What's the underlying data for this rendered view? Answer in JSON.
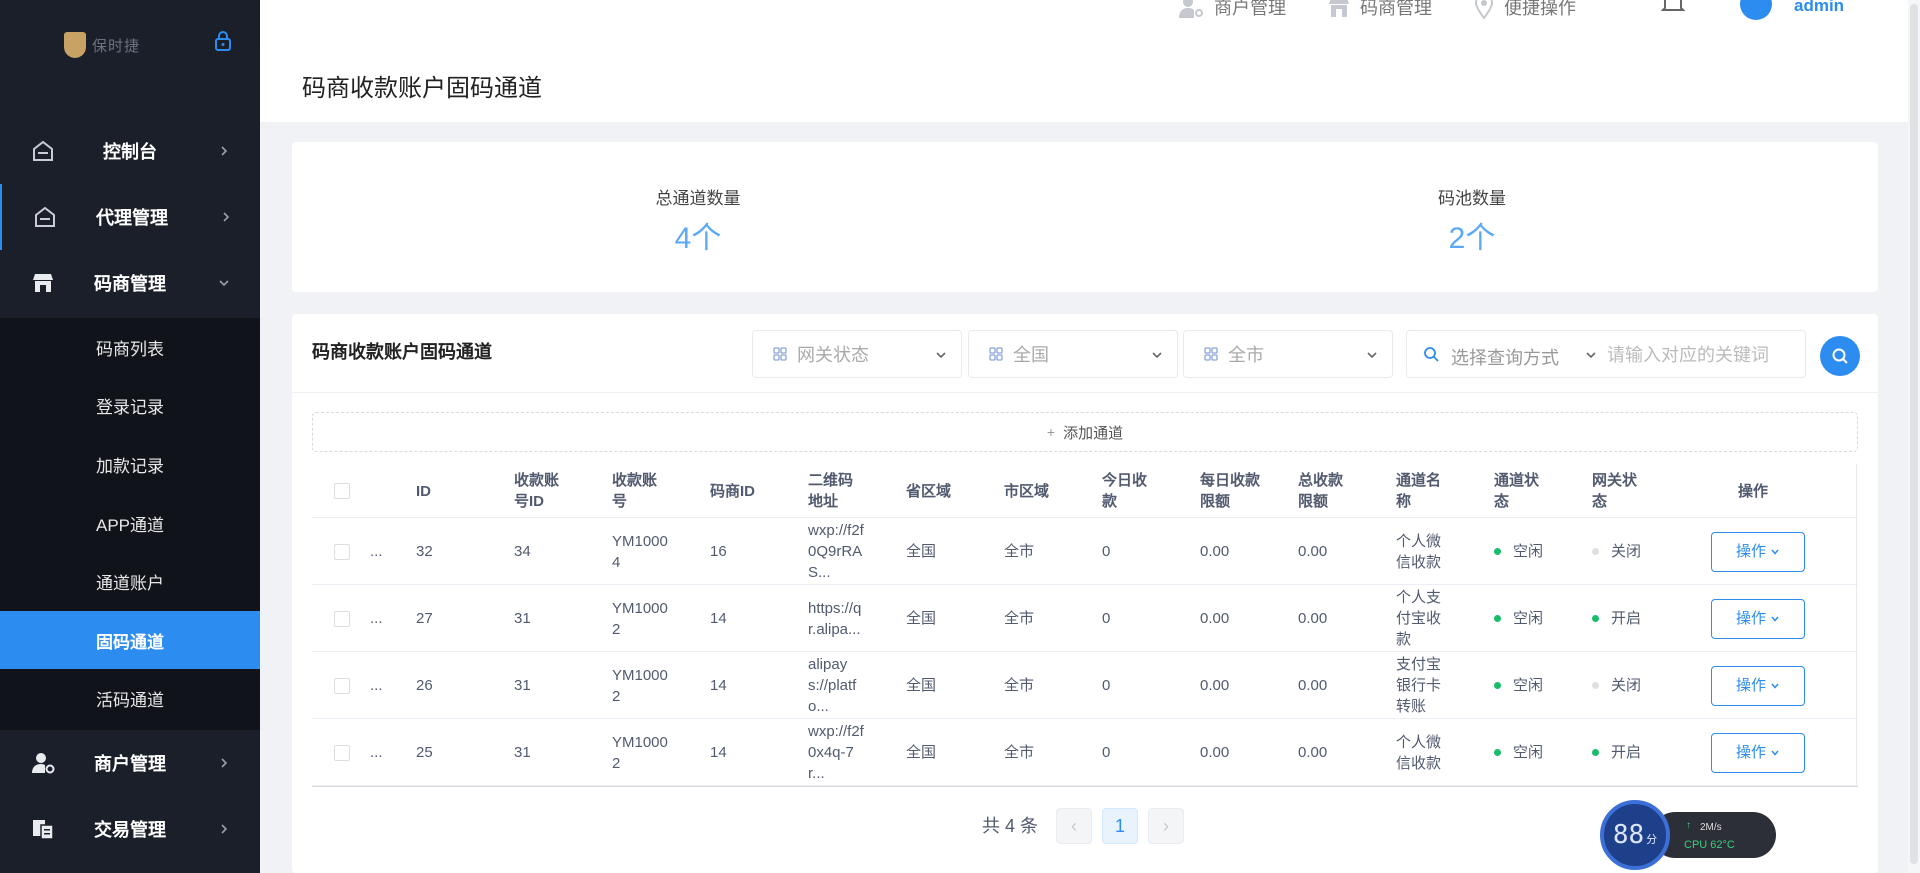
{
  "sidebar": {
    "logo_text": "保时捷",
    "menu": [
      {
        "label": "控制台",
        "icon": "home-icon"
      },
      {
        "label": "代理管理",
        "icon": "home-icon"
      },
      {
        "label": "码商管理",
        "icon": "store-icon"
      },
      {
        "label": "商户管理",
        "icon": "user-settings-icon"
      },
      {
        "label": "交易管理",
        "icon": "document-icon"
      }
    ],
    "submenu": [
      "码商列表",
      "登录记录",
      "加款记录",
      "APP通道",
      "通道账户",
      "固码通道",
      "活码通道"
    ],
    "selected_submenu": "固码通道"
  },
  "header": {
    "merchant_label": "商户管理",
    "code_merchant_label": "码商管理",
    "quick_label": "便捷操作",
    "username": "admin"
  },
  "page": {
    "title": "码商收款账户固码通道"
  },
  "stats": {
    "total_channels_label": "总通道数量",
    "total_channels_value": "4个",
    "pool_label": "码池数量",
    "pool_value": "2个"
  },
  "card": {
    "title": "码商收款账户固码通道",
    "filters": {
      "gateway_status": "网关状态",
      "province": "全国",
      "city": "全市"
    },
    "search": {
      "type_placeholder": "选择查询方式",
      "keyword_placeholder": "请输入对应的关键词"
    },
    "add_label": "添加通道"
  },
  "table": {
    "headers": {
      "id": "ID",
      "account_id": "收款账号ID",
      "account_no": "收款账号",
      "merchant_id": "码商ID",
      "qr": "二维码地址",
      "province": "省区域",
      "city": "市区域",
      "today": "今日收款",
      "daily_limit": "每日收款限额",
      "total_limit": "总收款限额",
      "channel_name": "通道名称",
      "channel_status": "通道状态",
      "gateway_status": "网关状态",
      "ops": "操作"
    },
    "rows": [
      {
        "ellipsis": "...",
        "id": "32",
        "account_id": "34",
        "account_no": "YM10004",
        "merchant_id": "16",
        "qr": "wxp://f2f0Q9rRAS...",
        "province": "全国",
        "city": "全市",
        "today": "0",
        "daily_limit": "0.00",
        "total_limit": "0.00",
        "channel_name": "个人微信收款",
        "channel_status": "空闲",
        "gateway_status": "关闭",
        "gateway_on": false,
        "op": "操作"
      },
      {
        "ellipsis": "...",
        "id": "27",
        "account_id": "31",
        "account_no": "YM10002",
        "merchant_id": "14",
        "qr": "https://qr.alipa...",
        "province": "全国",
        "city": "全市",
        "today": "0",
        "daily_limit": "0.00",
        "total_limit": "0.00",
        "channel_name": "个人支付宝收款",
        "channel_status": "空闲",
        "gateway_status": "开启",
        "gateway_on": true,
        "op": "操作"
      },
      {
        "ellipsis": "...",
        "id": "26",
        "account_id": "31",
        "account_no": "YM10002",
        "merchant_id": "14",
        "qr": "alipays://platfo...",
        "province": "全国",
        "city": "全市",
        "today": "0",
        "daily_limit": "0.00",
        "total_limit": "0.00",
        "channel_name": "支付宝银行卡转账",
        "channel_status": "空闲",
        "gateway_status": "关闭",
        "gateway_on": false,
        "op": "操作"
      },
      {
        "ellipsis": "...",
        "id": "25",
        "account_id": "31",
        "account_no": "YM10002",
        "merchant_id": "14",
        "qr": "wxp://f2f0x4q-7r...",
        "province": "全国",
        "city": "全市",
        "today": "0",
        "daily_limit": "0.00",
        "total_limit": "0.00",
        "channel_name": "个人微信收款",
        "channel_status": "空闲",
        "gateway_status": "开启",
        "gateway_on": true,
        "op": "操作"
      }
    ]
  },
  "pagination": {
    "total_text": "共 4 条",
    "current_page": "1",
    "prev": "‹",
    "next": "›"
  },
  "monitor": {
    "score": "88",
    "unit": "分",
    "net_arrow": "↑",
    "net_speed": "2M/s",
    "cpu": "CPU 62°C"
  },
  "colors": {
    "accent": "#2d8cf0",
    "sidebar_bg": "#1b1f2a",
    "submenu_bg": "#11131a",
    "stat_value": "#5aa9f5",
    "status_green": "#19be6b",
    "status_gray": "#e0e0e0"
  }
}
